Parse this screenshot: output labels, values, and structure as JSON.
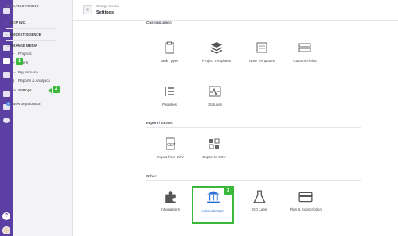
{
  "rail": {
    "icons": [
      "home-icon",
      "briefcase-icon",
      "grid-icon",
      "building-icon",
      "people-icon",
      "wrench-icon",
      "search-icon",
      "plus-icon"
    ],
    "help_label": "?"
  },
  "sidebar": {
    "title": "ORGANIZATIONS",
    "orgs": [
      {
        "name": "GCP, INC.",
        "chevron": "›"
      },
      {
        "name": "ROCKET SCIENCE",
        "chevron": "›"
      },
      {
        "name": "ORANGE MEDIA",
        "chevron": "⌄"
      }
    ],
    "items": [
      {
        "label": "Projects",
        "icon": "briefcase-icon"
      },
      {
        "label": "Users",
        "icon": "people-icon"
      },
      {
        "label": "Big Screens",
        "icon": "monitor-icon"
      },
      {
        "label": "Reports & Analytics",
        "icon": "chart-icon"
      },
      {
        "label": "Settings",
        "icon": "gear-icon"
      }
    ],
    "new_org": "New organization"
  },
  "header": {
    "org_name": "Orange Media",
    "title": "Settings"
  },
  "sections": {
    "customization": "Customization",
    "import_export": "Import / Export",
    "other": "Other"
  },
  "tiles": {
    "task_types": "Task Types",
    "project_templates": "Project Templates",
    "note_templates": "Note Templates",
    "custom_fields": "Custom Fields",
    "priorities": "Priorities",
    "statuses": "Statuses",
    "import_csv": "Import from CSV",
    "export_csv": "Export to CSV",
    "integrations": "Integrations",
    "administration": "Administration",
    "gq_labs": "GQ Labs",
    "plan_subscription": "Plan & Subscription"
  },
  "annotations": {
    "badge1": "1",
    "badge2": "2",
    "badge3": "3"
  },
  "colors": {
    "rail": "#5b3fa3",
    "highlight": "#3ab83a",
    "link": "#2c6fd9"
  }
}
